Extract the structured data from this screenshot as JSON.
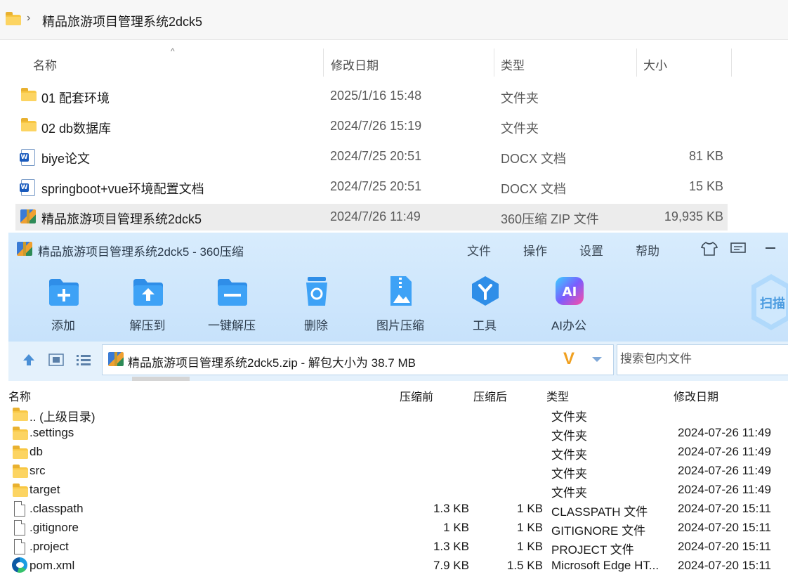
{
  "explorer": {
    "breadcrumb": "精品旅游项目管理系统2dck5",
    "columns": {
      "name": "名称",
      "modified": "修改日期",
      "type": "类型",
      "size": "大小"
    },
    "rows": [
      {
        "name": "01 配套环境",
        "date": "2025/1/16 15:48",
        "type": "文件夹",
        "size": "",
        "icon": "folder-icon"
      },
      {
        "name": "02 db数据库",
        "date": "2024/7/26 15:19",
        "type": "文件夹",
        "size": "",
        "icon": "folder-icon"
      },
      {
        "name": "biye论文",
        "date": "2024/7/25 20:51",
        "type": "DOCX 文档",
        "size": "81 KB",
        "icon": "word-doc-icon"
      },
      {
        "name": "springboot+vue环境配置文档",
        "date": "2024/7/25 20:51",
        "type": "DOCX 文档",
        "size": "15 KB",
        "icon": "word-doc-icon"
      },
      {
        "name": "精品旅游项目管理系统2dck5",
        "date": "2024/7/26 11:49",
        "type": "360压缩 ZIP 文件",
        "size": "19,935 KB",
        "icon": "zip-archive-icon"
      }
    ]
  },
  "zip_window": {
    "title": "精品旅游项目管理系统2dck5 - 360压缩",
    "menu": [
      "文件",
      "操作",
      "设置",
      "帮助"
    ],
    "toolbar": [
      {
        "label": "添加",
        "icon": "add-icon"
      },
      {
        "label": "解压到",
        "icon": "extract-to-icon"
      },
      {
        "label": "一键解压",
        "icon": "one-click-extract-icon"
      },
      {
        "label": "删除",
        "icon": "delete-icon"
      },
      {
        "label": "图片压缩",
        "icon": "image-compress-icon"
      },
      {
        "label": "工具",
        "icon": "tools-icon"
      },
      {
        "label": "AI办公",
        "icon": "ai-office-icon"
      }
    ],
    "scan_label": "扫描",
    "path": "精品旅游项目管理系统2dck5.zip - 解包大小为 38.7 MB",
    "search_placeholder": "搜索包内文件",
    "columns": {
      "name": "名称",
      "before": "压缩前",
      "after": "压缩后",
      "type": "类型",
      "modified": "修改日期"
    },
    "rows": [
      {
        "name": ".. (上级目录)",
        "before": "",
        "after": "",
        "type": "文件夹",
        "date": "",
        "icon": "folder-icon"
      },
      {
        "name": ".settings",
        "before": "",
        "after": "",
        "type": "文件夹",
        "date": "2024-07-26 11:49",
        "icon": "folder-icon"
      },
      {
        "name": "db",
        "before": "",
        "after": "",
        "type": "文件夹",
        "date": "2024-07-26 11:49",
        "icon": "folder-icon"
      },
      {
        "name": "src",
        "before": "",
        "after": "",
        "type": "文件夹",
        "date": "2024-07-26 11:49",
        "icon": "folder-icon"
      },
      {
        "name": "target",
        "before": "",
        "after": "",
        "type": "文件夹",
        "date": "2024-07-26 11:49",
        "icon": "folder-icon"
      },
      {
        "name": ".classpath",
        "before": "1.3 KB",
        "after": "1 KB",
        "type": "CLASSPATH 文件",
        "date": "2024-07-20 15:11",
        "icon": "file-icon"
      },
      {
        "name": ".gitignore",
        "before": "1 KB",
        "after": "1 KB",
        "type": "GITIGNORE 文件",
        "date": "2024-07-20 15:11",
        "icon": "file-icon"
      },
      {
        "name": ".project",
        "before": "1.3 KB",
        "after": "1 KB",
        "type": "PROJECT 文件",
        "date": "2024-07-20 15:11",
        "icon": "file-icon"
      },
      {
        "name": "pom.xml",
        "before": "7.9 KB",
        "after": "1.5 KB",
        "type": "Microsoft Edge HT...",
        "date": "2024-07-20 15:11",
        "icon": "edge-icon"
      }
    ]
  }
}
